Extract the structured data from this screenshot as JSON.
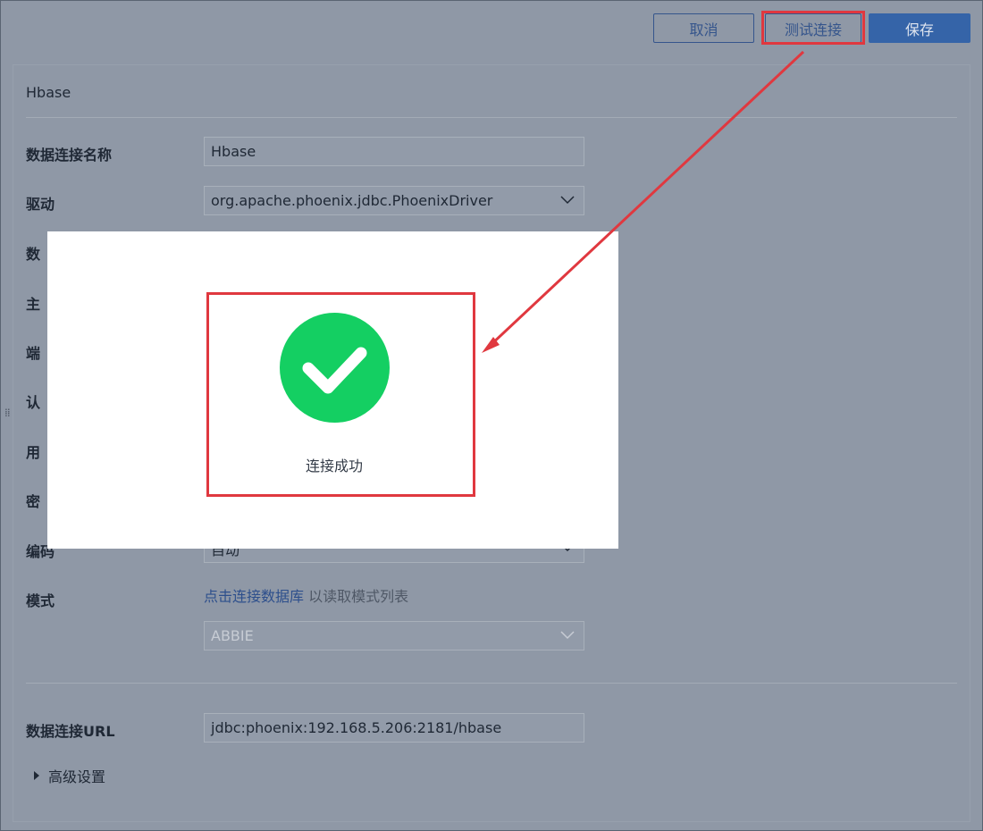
{
  "toolbar": {
    "cancel_label": "取消",
    "test_label": "测试连接",
    "save_label": "保存"
  },
  "panel": {
    "title": "Hbase"
  },
  "form": {
    "name_label": "数据连接名称",
    "name_value": "Hbase",
    "driver_label": "驱动",
    "driver_value": "org.apache.phoenix.jdbc.PhoenixDriver",
    "db_label_partial": "数",
    "host_label_partial": "主",
    "port_label_partial": "端",
    "auth_label_partial": "认",
    "user_label_partial": "用",
    "password_label_partial": "密",
    "encoding_label": "编码",
    "encoding_value": "自动",
    "schema_label": "模式",
    "schema_link": "点击连接数据库",
    "schema_hint": "以读取模式列表",
    "schema_value": "ABBIE",
    "url_label": "数据连接URL",
    "url_value": "jdbc:phoenix:192.168.5.206:2181/hbase",
    "advanced_label": "高级设置"
  },
  "dialog": {
    "message": "连接成功"
  },
  "colors": {
    "overlay": "#8f98a6",
    "primary": "#3564a8",
    "success": "#14cf62",
    "annotation": "#e0383f"
  },
  "icons": {
    "success": "check-circle-icon",
    "dropdown": "chevron-down-icon",
    "expand": "caret-right-icon",
    "drag": "drag-handle-icon"
  }
}
